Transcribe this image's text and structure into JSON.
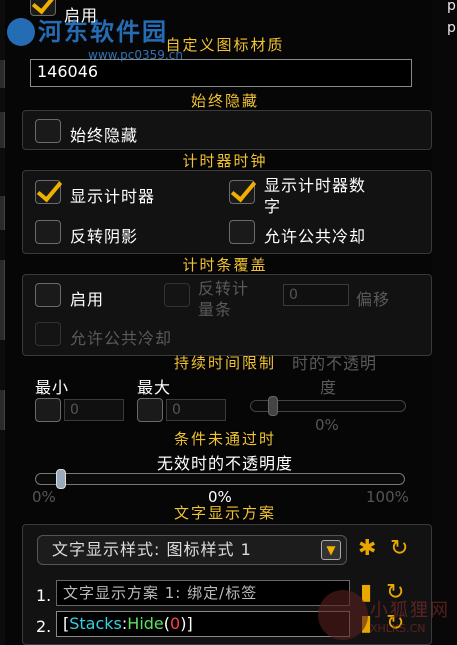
{
  "watermark": {
    "site": "河东软件园",
    "url": "www.pc0359.cn"
  },
  "right_letters": [
    "p",
    "p"
  ],
  "top": {
    "enabled_label": "启用",
    "material_header": "自定义图标材质",
    "material_value": "146046"
  },
  "always_hide": {
    "header": "始终隐藏",
    "checkbox_label": "始终隐藏"
  },
  "timer_clock": {
    "header": "计时器时钟",
    "show_timer": "显示计时器",
    "show_timer_numbers_line1": "显示计时器数",
    "show_timer_numbers_line2": "字",
    "reverse_shadow": "反转阴影",
    "allow_gcd": "允许公共冷却"
  },
  "timer_bar": {
    "header": "计时条覆盖",
    "enabled_label": "启用",
    "reverse_bar_line1": "反转计",
    "reverse_bar_line2": "量条",
    "offset_value": "0",
    "offset_label": "偏移",
    "allow_gcd": "允许公共冷却"
  },
  "duration_limit": {
    "header": "持续时间限制",
    "overlay_text_line1": "时的不透明",
    "overlay_text_line2": "度",
    "min_label": "最小",
    "max_label": "最大",
    "min_value": "0",
    "max_value": "0",
    "slider_value": "0%",
    "slider_fraction": 0.05
  },
  "condition_fail": {
    "header": "条件未通过时",
    "opacity_label": "无效时的不透明度",
    "min_tick": "0%",
    "max_tick": "100%",
    "value": "0%",
    "slider_fraction": 0.05
  },
  "text_scheme": {
    "header": "文字显示方案",
    "dropdown_value": "文字显示样式: 图标样式 1",
    "row1_index": "1.",
    "row1_text": "文字显示方案 1: 绑定/标签",
    "row2_index": "2.",
    "row2_open": "[",
    "row2_stacks": "Stacks",
    "row2_colon": ":",
    "row2_hide": "Hide",
    "row2_paren_open": "(",
    "row2_zero": "0",
    "row2_paren_close": ")",
    "row2_close": "]"
  },
  "colors": {
    "header_gold": "#f1c232",
    "check_gold": "#f0b000",
    "stacks_cyan": "#37d0e0",
    "hide_green": "#5fe05f",
    "zero_red": "#ff4040"
  },
  "fox_watermark": {
    "line1": "小狐狸网",
    "line2": "XHLKS.CN"
  }
}
